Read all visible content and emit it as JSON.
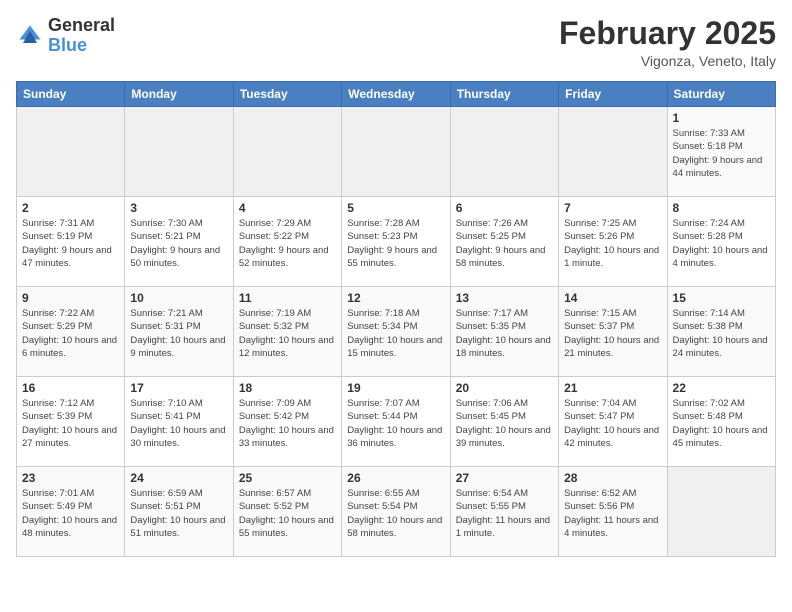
{
  "header": {
    "logo_general": "General",
    "logo_blue": "Blue",
    "title": "February 2025",
    "subtitle": "Vigonza, Veneto, Italy"
  },
  "weekdays": [
    "Sunday",
    "Monday",
    "Tuesday",
    "Wednesday",
    "Thursday",
    "Friday",
    "Saturday"
  ],
  "weeks": [
    [
      {
        "day": "",
        "info": ""
      },
      {
        "day": "",
        "info": ""
      },
      {
        "day": "",
        "info": ""
      },
      {
        "day": "",
        "info": ""
      },
      {
        "day": "",
        "info": ""
      },
      {
        "day": "",
        "info": ""
      },
      {
        "day": "1",
        "info": "Sunrise: 7:33 AM\nSunset: 5:18 PM\nDaylight: 9 hours and 44 minutes."
      }
    ],
    [
      {
        "day": "2",
        "info": "Sunrise: 7:31 AM\nSunset: 5:19 PM\nDaylight: 9 hours and 47 minutes."
      },
      {
        "day": "3",
        "info": "Sunrise: 7:30 AM\nSunset: 5:21 PM\nDaylight: 9 hours and 50 minutes."
      },
      {
        "day": "4",
        "info": "Sunrise: 7:29 AM\nSunset: 5:22 PM\nDaylight: 9 hours and 52 minutes."
      },
      {
        "day": "5",
        "info": "Sunrise: 7:28 AM\nSunset: 5:23 PM\nDaylight: 9 hours and 55 minutes."
      },
      {
        "day": "6",
        "info": "Sunrise: 7:26 AM\nSunset: 5:25 PM\nDaylight: 9 hours and 58 minutes."
      },
      {
        "day": "7",
        "info": "Sunrise: 7:25 AM\nSunset: 5:26 PM\nDaylight: 10 hours and 1 minute."
      },
      {
        "day": "8",
        "info": "Sunrise: 7:24 AM\nSunset: 5:28 PM\nDaylight: 10 hours and 4 minutes."
      }
    ],
    [
      {
        "day": "9",
        "info": "Sunrise: 7:22 AM\nSunset: 5:29 PM\nDaylight: 10 hours and 6 minutes."
      },
      {
        "day": "10",
        "info": "Sunrise: 7:21 AM\nSunset: 5:31 PM\nDaylight: 10 hours and 9 minutes."
      },
      {
        "day": "11",
        "info": "Sunrise: 7:19 AM\nSunset: 5:32 PM\nDaylight: 10 hours and 12 minutes."
      },
      {
        "day": "12",
        "info": "Sunrise: 7:18 AM\nSunset: 5:34 PM\nDaylight: 10 hours and 15 minutes."
      },
      {
        "day": "13",
        "info": "Sunrise: 7:17 AM\nSunset: 5:35 PM\nDaylight: 10 hours and 18 minutes."
      },
      {
        "day": "14",
        "info": "Sunrise: 7:15 AM\nSunset: 5:37 PM\nDaylight: 10 hours and 21 minutes."
      },
      {
        "day": "15",
        "info": "Sunrise: 7:14 AM\nSunset: 5:38 PM\nDaylight: 10 hours and 24 minutes."
      }
    ],
    [
      {
        "day": "16",
        "info": "Sunrise: 7:12 AM\nSunset: 5:39 PM\nDaylight: 10 hours and 27 minutes."
      },
      {
        "day": "17",
        "info": "Sunrise: 7:10 AM\nSunset: 5:41 PM\nDaylight: 10 hours and 30 minutes."
      },
      {
        "day": "18",
        "info": "Sunrise: 7:09 AM\nSunset: 5:42 PM\nDaylight: 10 hours and 33 minutes."
      },
      {
        "day": "19",
        "info": "Sunrise: 7:07 AM\nSunset: 5:44 PM\nDaylight: 10 hours and 36 minutes."
      },
      {
        "day": "20",
        "info": "Sunrise: 7:06 AM\nSunset: 5:45 PM\nDaylight: 10 hours and 39 minutes."
      },
      {
        "day": "21",
        "info": "Sunrise: 7:04 AM\nSunset: 5:47 PM\nDaylight: 10 hours and 42 minutes."
      },
      {
        "day": "22",
        "info": "Sunrise: 7:02 AM\nSunset: 5:48 PM\nDaylight: 10 hours and 45 minutes."
      }
    ],
    [
      {
        "day": "23",
        "info": "Sunrise: 7:01 AM\nSunset: 5:49 PM\nDaylight: 10 hours and 48 minutes."
      },
      {
        "day": "24",
        "info": "Sunrise: 6:59 AM\nSunset: 5:51 PM\nDaylight: 10 hours and 51 minutes."
      },
      {
        "day": "25",
        "info": "Sunrise: 6:57 AM\nSunset: 5:52 PM\nDaylight: 10 hours and 55 minutes."
      },
      {
        "day": "26",
        "info": "Sunrise: 6:55 AM\nSunset: 5:54 PM\nDaylight: 10 hours and 58 minutes."
      },
      {
        "day": "27",
        "info": "Sunrise: 6:54 AM\nSunset: 5:55 PM\nDaylight: 11 hours and 1 minute."
      },
      {
        "day": "28",
        "info": "Sunrise: 6:52 AM\nSunset: 5:56 PM\nDaylight: 11 hours and 4 minutes."
      },
      {
        "day": "",
        "info": ""
      }
    ]
  ]
}
